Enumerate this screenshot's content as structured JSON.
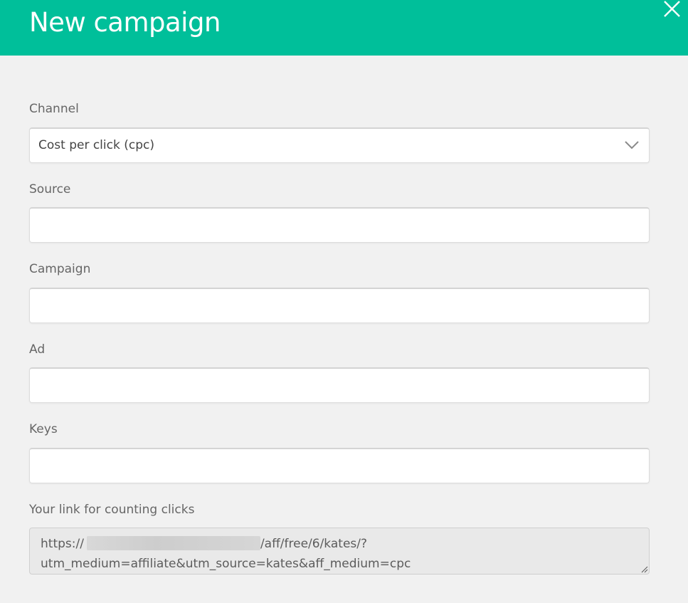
{
  "dialog": {
    "title": "New campaign",
    "close_icon": "close-icon"
  },
  "form": {
    "channel": {
      "label": "Channel",
      "value": "Cost per click (cpc)",
      "icon": "chevron-down-icon"
    },
    "source": {
      "label": "Source",
      "value": ""
    },
    "campaign": {
      "label": "Campaign",
      "value": ""
    },
    "ad": {
      "label": "Ad",
      "value": ""
    },
    "keys": {
      "label": "Keys",
      "value": ""
    },
    "link": {
      "label": "Your link for counting clicks",
      "prefix": "https://",
      "suffix": "/aff/free/6/kates/?",
      "line2": "utm_medium=affiliate&utm_source=kates&aff_medium=cpc"
    }
  },
  "colors": {
    "header": "#00bf9a",
    "background": "#f1f1f1"
  }
}
